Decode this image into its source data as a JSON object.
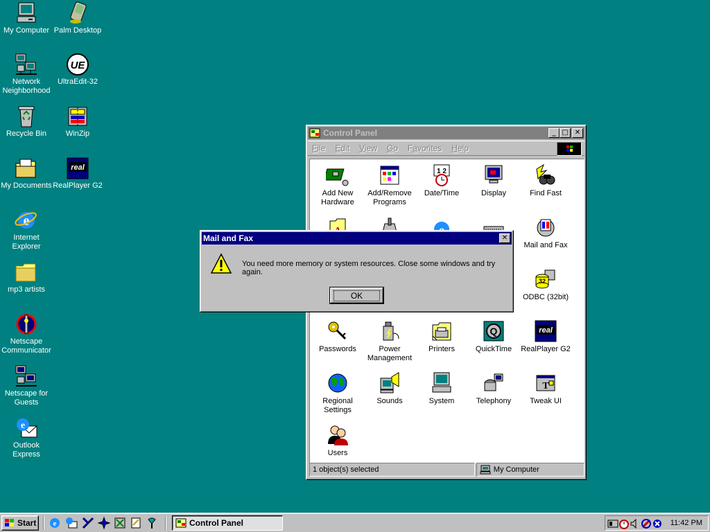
{
  "desktop": {
    "icons": [
      {
        "label": "My Computer",
        "icon": "my-computer-icon"
      },
      {
        "label": "Palm Desktop",
        "icon": "palm-desktop-icon"
      },
      {
        "label": "Network Neighborhood",
        "icon": "network-neighborhood-icon"
      },
      {
        "label": "UltraEdit-32",
        "icon": "ultraedit-icon"
      },
      {
        "label": "Recycle Bin",
        "icon": "recycle-bin-icon"
      },
      {
        "label": "WinZip",
        "icon": "winzip-icon"
      },
      {
        "label": "My Documents",
        "icon": "my-documents-icon"
      },
      {
        "label": "RealPlayer G2",
        "icon": "realplayer-icon"
      },
      {
        "label": "Internet Explorer",
        "icon": "internet-explorer-icon"
      },
      {
        "label": "mp3 artists",
        "icon": "folder-icon"
      },
      {
        "label": "Netscape Communicator",
        "icon": "netscape-communicator-icon"
      },
      {
        "label": "Netscape for Guests",
        "icon": "netscape-guests-icon"
      },
      {
        "label": "Outlook Express",
        "icon": "outlook-express-icon"
      }
    ]
  },
  "control_panel": {
    "title": "Control Panel",
    "menu": [
      "File",
      "Edit",
      "View",
      "Go",
      "Favorites",
      "Help"
    ],
    "menu_accel": [
      "F",
      "E",
      "V",
      "G",
      "a",
      "H"
    ],
    "items": [
      {
        "label": "Add New Hardware",
        "icon": "add-hardware-icon"
      },
      {
        "label": "Add/Remove Programs",
        "icon": "add-remove-programs-icon"
      },
      {
        "label": "Date/Time",
        "icon": "date-time-icon"
      },
      {
        "label": "Display",
        "icon": "display-icon"
      },
      {
        "label": "Find Fast",
        "icon": "find-fast-icon"
      },
      {
        "label": "Mail and Fax",
        "icon": "mail-fax-icon"
      },
      {
        "label": "ODBC (32bit)",
        "icon": "odbc-icon"
      },
      {
        "label": "Passwords",
        "icon": "passwords-icon"
      },
      {
        "label": "Power Management",
        "icon": "power-management-icon"
      },
      {
        "label": "Printers",
        "icon": "printers-icon"
      },
      {
        "label": "QuickTime",
        "icon": "quicktime-icon"
      },
      {
        "label": "RealPlayer G2",
        "icon": "realplayer-icon"
      },
      {
        "label": "Regional Settings",
        "icon": "regional-settings-icon"
      },
      {
        "label": "Sounds",
        "icon": "sounds-icon"
      },
      {
        "label": "System",
        "icon": "system-icon"
      },
      {
        "label": "Telephony",
        "icon": "telephony-icon"
      },
      {
        "label": "Tweak UI",
        "icon": "tweak-ui-icon"
      },
      {
        "label": "Users",
        "icon": "users-icon"
      }
    ],
    "status_left": "1 object(s) selected",
    "status_right": "My Computer"
  },
  "dialog": {
    "title": "Mail and Fax",
    "message": "You need more memory or system resources. Close some windows and try again.",
    "ok_label": "OK"
  },
  "taskbar": {
    "start_label": "Start",
    "task_label": "Control Panel",
    "clock": "11:42 PM"
  },
  "colors": {
    "desktop": "#008080",
    "active_title": "#000080",
    "inactive_title": "#808080",
    "face": "#c0c0c0"
  }
}
